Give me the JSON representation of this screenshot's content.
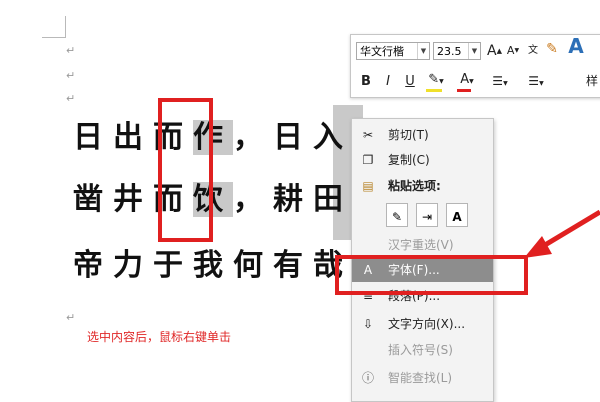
{
  "document": {
    "poem_lines": [
      [
        "日出而",
        "作",
        "，日入而息"
      ],
      [
        "凿井而",
        "饮",
        "，耕田而食"
      ],
      [
        "帝力于我何有哉！"
      ]
    ],
    "annotation": "选中内容后，鼠标右键单击",
    "para_mark": "↵"
  },
  "mini_toolbar": {
    "font_name": "华文行楷",
    "font_size": "23.5",
    "grow_font": "A",
    "shrink_font": "A",
    "phonetic": "文",
    "styles_glyph": "A",
    "bold": "B",
    "italic": "I",
    "underline": "U",
    "font_color": "A",
    "styles_label": "样"
  },
  "context_menu": {
    "items": [
      {
        "label": "剪切(T)",
        "icon": "scissors-icon",
        "enabled": true
      },
      {
        "label": "复制(C)",
        "icon": "copy-icon",
        "enabled": true
      },
      {
        "label": "粘贴选项:",
        "icon": "paste-icon",
        "enabled": true
      },
      {
        "label": "汉字重选(V)",
        "icon": "",
        "enabled": false
      },
      {
        "label": "字体(F)...",
        "icon": "font-icon",
        "enabled": true,
        "highlighted": true
      },
      {
        "label": "段落(P)...",
        "icon": "paragraph-icon",
        "enabled": true
      },
      {
        "label": "文字方向(X)...",
        "icon": "text-direction-icon",
        "enabled": true
      },
      {
        "label": "插入符号(S)",
        "icon": "",
        "enabled": false
      },
      {
        "label": "智能查找(L)",
        "icon": "smart-lookup-icon",
        "enabled": false
      }
    ],
    "paste_option_glyphs": [
      "✎",
      "⇥",
      "A"
    ]
  },
  "colors": {
    "highlight_box": "#e02020",
    "selection": "#c9c9c9",
    "menu_hover": "#8d8d8d"
  }
}
